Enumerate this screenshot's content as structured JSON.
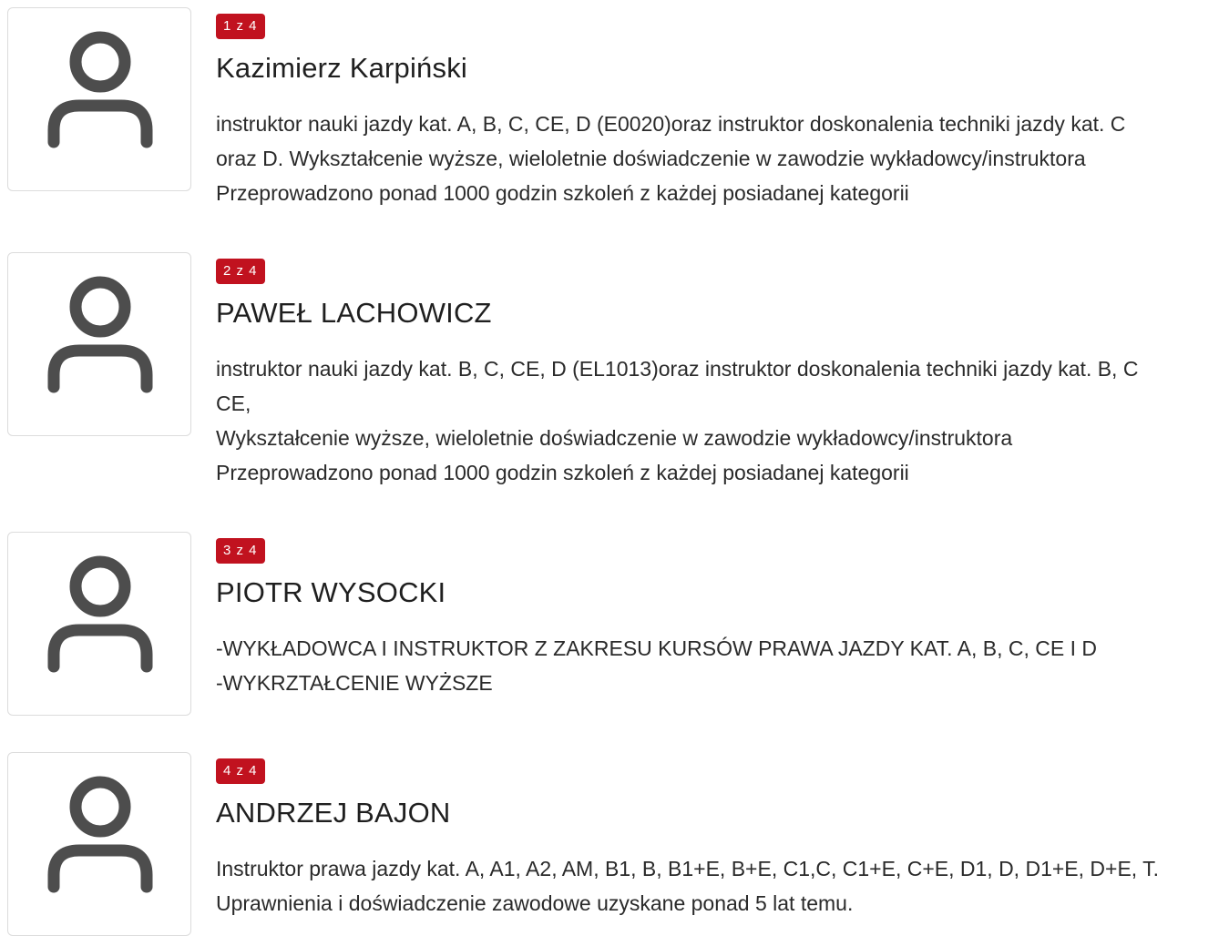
{
  "instructors": [
    {
      "counter": "1 z 4",
      "name": "Kazimierz Karpiński",
      "description": "instruktor nauki jazdy kat. A, B, C, CE, D (E0020)oraz instruktor doskonalenia techniki jazdy kat. C\noraz D. Wykształcenie wyższe, wieloletnie doświadczenie w zawodzie wykładowcy/instruktora\nPrzeprowadzono ponad 1000 godzin szkoleń z każdej posiadanej kategorii",
      "avatar_icon": "user-icon"
    },
    {
      "counter": "2 z 4",
      "name": "PAWEŁ LACHOWICZ",
      "description": "instruktor nauki jazdy kat. B, C, CE, D (EL1013)oraz instruktor doskonalenia techniki jazdy kat. B, C\nCE,\nWykształcenie wyższe, wieloletnie doświadczenie w zawodzie wykładowcy/instruktora\nPrzeprowadzono ponad 1000 godzin szkoleń z każdej posiadanej kategorii",
      "avatar_icon": "user-icon"
    },
    {
      "counter": "3 z 4",
      "name": "PIOTR WYSOCKI",
      "description": "-WYKŁADOWCA I INSTRUKTOR Z ZAKRESU KURSÓW PRAWA JAZDY KAT. A, B, C, CE I D\n-WYKRZTAŁCENIE WYŻSZE",
      "avatar_icon": "user-icon"
    },
    {
      "counter": "4 z 4",
      "name": "ANDRZEJ BAJON",
      "description": "Instruktor prawa jazdy kat. A, A1, A2, AM, B1, B, B1+E, B+E, C1,C, C1+E, C+E, D1, D, D1+E, D+E, T.\nUprawnienia i doświadczenie zawodowe uzyskane ponad 5 lat temu.",
      "avatar_icon": "user-icon"
    }
  ],
  "colors": {
    "badge": "#c1121f",
    "icon": "#4d4d4d",
    "border": "#dcdcdc"
  }
}
